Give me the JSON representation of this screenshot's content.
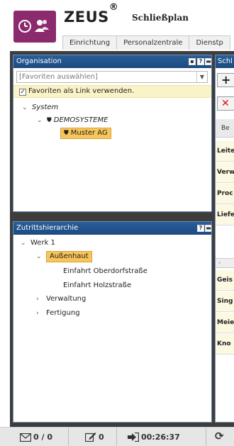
{
  "header": {
    "app_name": "ZEUS",
    "registered_mark": "®",
    "subtitle": "Schließplan",
    "nav_tabs": [
      "Einrichtung",
      "Personalzentrale",
      "Dienstp"
    ]
  },
  "organisation": {
    "title": "Organisation",
    "favorites_placeholder": "[Favoriten auswählen]",
    "favorites_link_label": "Favoriten als Link verwenden.",
    "favorites_link_checked": true,
    "tree": {
      "root": "System",
      "child": "DEMOSYSTEME",
      "selected": "Muster AG"
    }
  },
  "zutrittshierarchie": {
    "title": "Zutrittshierarchie",
    "root": "Werk 1",
    "selected": "Außenhaut",
    "children": [
      "Einfahrt Oberdorfstraße",
      "Einfahrt Holzstraße"
    ],
    "siblings": [
      "Verwaltung",
      "Fertigung"
    ]
  },
  "right_panel": {
    "title": "Schl",
    "add_label": "+",
    "delete_label": "✕",
    "column_header": "Be",
    "rows_top": [
      "Leite",
      "Verw",
      "Proc",
      "Liefe"
    ],
    "rows_bottom": [
      "Geis",
      "Sing",
      "Meie",
      "Kno"
    ]
  },
  "status_bar": {
    "messages": "0 / 0",
    "notes": "0",
    "session_time": "00:26:37"
  },
  "colors": {
    "brand": "#8b2a6c",
    "panel_header": "#1b4a80",
    "selected_node": "#f7c55a",
    "favorites_bg": "#faf3c8"
  }
}
